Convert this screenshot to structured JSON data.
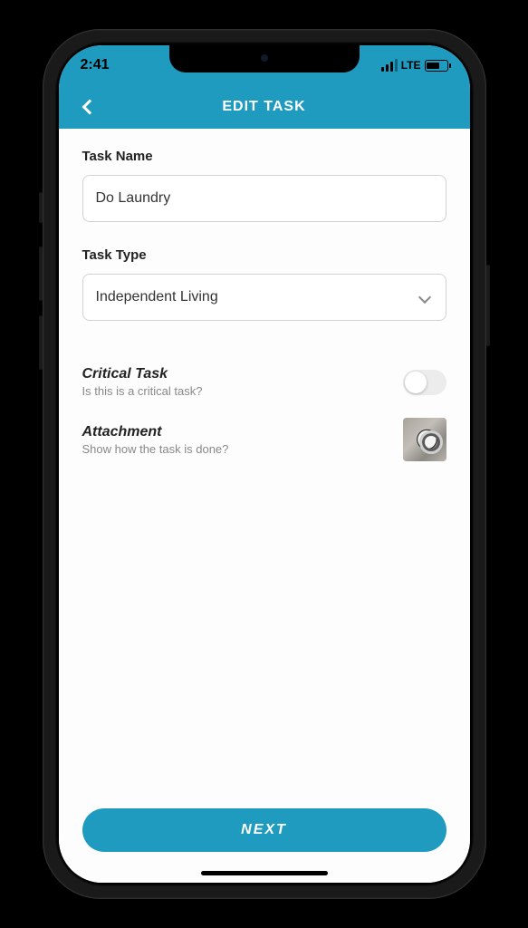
{
  "status": {
    "time": "2:41",
    "network": "LTE"
  },
  "header": {
    "title": "EDIT TASK"
  },
  "form": {
    "task_name_label": "Task Name",
    "task_name_value": "Do Laundry",
    "task_type_label": "Task Type",
    "task_type_value": "Independent Living",
    "critical": {
      "title": "Critical Task",
      "subtitle": "Is this is a critical task?",
      "value": false
    },
    "attachment": {
      "title": "Attachment",
      "subtitle": "Show how the task is done?"
    }
  },
  "actions": {
    "next_label": "NEXT"
  }
}
